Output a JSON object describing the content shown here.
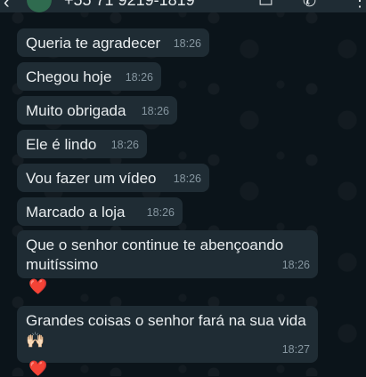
{
  "header": {
    "back_icon": "arrow-left-icon",
    "title": "+55 71 9219-1819",
    "video_icon": "video-call-icon",
    "call_icon": "phone-icon",
    "menu_icon": "more-vertical-icon"
  },
  "messages": [
    {
      "text": "Queria te agradecer",
      "time": "18:26"
    },
    {
      "text": "Chegou hoje",
      "time": "18:26"
    },
    {
      "text": "Muito obrigada",
      "time": "18:26"
    },
    {
      "text": "Ele é lindo",
      "time": "18:26"
    },
    {
      "text": "Vou fazer um vídeo",
      "time": "18:26"
    },
    {
      "text": "Marcado a loja",
      "time": "18:26"
    },
    {
      "text": "Que o senhor continue te abençoando muitíssimo",
      "time": "18:26",
      "reaction": "❤️"
    },
    {
      "text": "Grandes coisas o senhor fará na sua vida 🙌🏻",
      "time": "18:27",
      "reaction": "❤️"
    }
  ],
  "colors": {
    "background": "#0b141a",
    "bubble": "#1f2c34",
    "text": "#e9edef",
    "timestamp": "#8696a0"
  }
}
